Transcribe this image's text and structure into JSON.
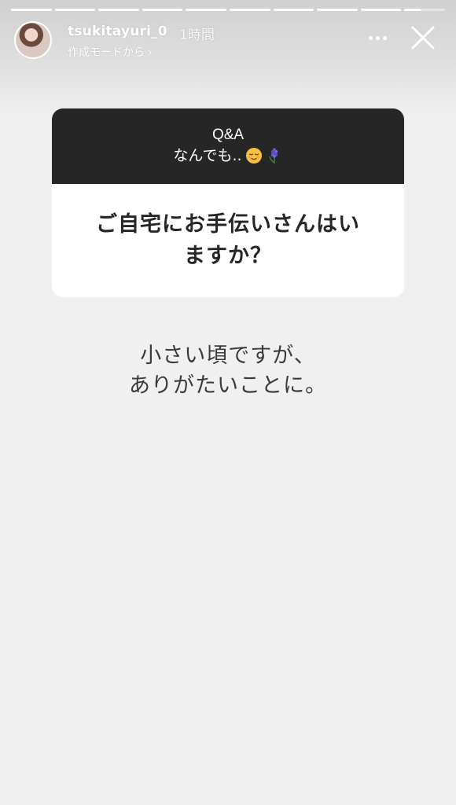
{
  "progress": {
    "segments": [
      1,
      1,
      1,
      1,
      1,
      1,
      1,
      1,
      1,
      0.4
    ],
    "segment_count": 10
  },
  "header": {
    "username": "tsukitayuri_0",
    "time": "1時間",
    "subline": "作成モードから",
    "subline_chevron": "›"
  },
  "card": {
    "header_line1": "Q&A",
    "header_line2": "なんでも..",
    "header_emojis": [
      "relieved-face",
      "hyacinth"
    ],
    "question_line1": "ご自宅にお手伝いさんはい",
    "question_line2": "ますか？"
  },
  "answer": {
    "line1": "小さい頃ですが、",
    "line2": "ありがたいことに。"
  },
  "colors": {
    "card_header_bg": "#262626",
    "card_body_bg": "#ffffff",
    "background": "#f0f0f0",
    "header_text": "#ffffff"
  },
  "icons": {
    "more": "more-horizontal-icon",
    "close": "close-icon"
  }
}
